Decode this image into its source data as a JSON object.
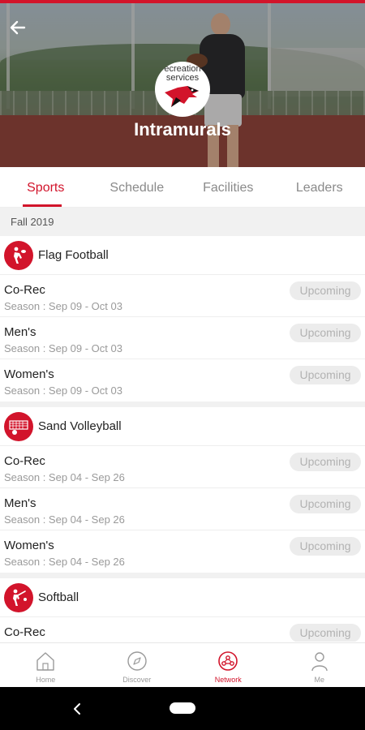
{
  "header": {
    "title": "Intramurals",
    "logo_text": "ecreation\nservices"
  },
  "tabs": [
    {
      "label": "Sports",
      "active": true
    },
    {
      "label": "Schedule",
      "active": false
    },
    {
      "label": "Facilities",
      "active": false
    },
    {
      "label": "Leaders",
      "active": false
    }
  ],
  "season_label": "Fall 2019",
  "sports": [
    {
      "name": "Flag Football",
      "icon": "flag-football-icon",
      "leagues": [
        {
          "name": "Co-Rec",
          "season": "Season : Sep 09 - Oct 03",
          "status": "Upcoming"
        },
        {
          "name": "Men's",
          "season": "Season : Sep 09 - Oct 03",
          "status": "Upcoming"
        },
        {
          "name": "Women's",
          "season": "Season : Sep 09 - Oct 03",
          "status": "Upcoming"
        }
      ]
    },
    {
      "name": "Sand Volleyball",
      "icon": "volleyball-icon",
      "leagues": [
        {
          "name": "Co-Rec",
          "season": "Season : Sep 04 - Sep 26",
          "status": "Upcoming"
        },
        {
          "name": "Men's",
          "season": "Season : Sep 04 - Sep 26",
          "status": "Upcoming"
        },
        {
          "name": "Women's",
          "season": "Season : Sep 04 - Sep 26",
          "status": "Upcoming"
        }
      ]
    },
    {
      "name": "Softball",
      "icon": "softball-icon",
      "leagues": [
        {
          "name": "Co-Rec",
          "season": "",
          "status": "Upcoming"
        }
      ]
    }
  ],
  "bottom_nav": [
    {
      "label": "Home",
      "icon": "home-icon",
      "active": false
    },
    {
      "label": "Discover",
      "icon": "compass-icon",
      "active": false
    },
    {
      "label": "Network",
      "icon": "network-icon",
      "active": true
    },
    {
      "label": "Me",
      "icon": "person-icon",
      "active": false
    }
  ],
  "colors": {
    "accent": "#d2142b",
    "badge_bg": "#ececec",
    "badge_text": "#b2b2b2"
  }
}
